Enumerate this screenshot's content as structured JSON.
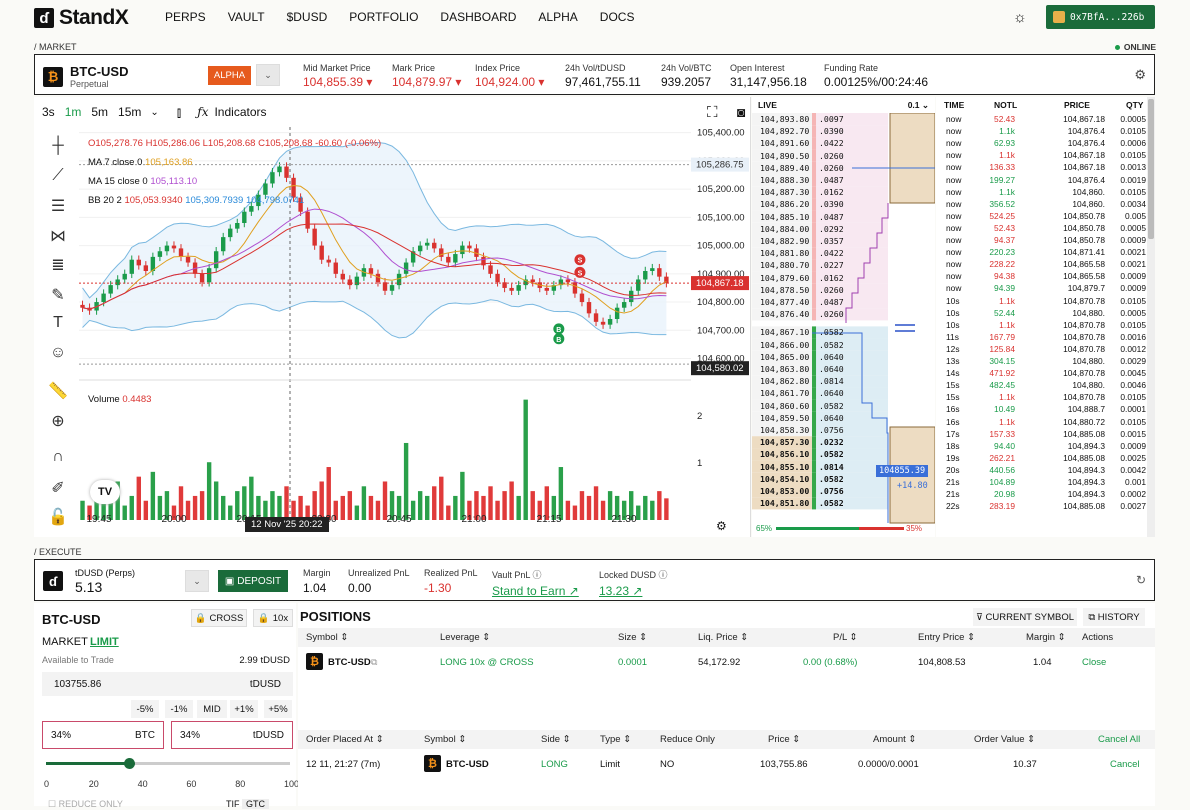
{
  "nav": {
    "logo": "StandX",
    "items": [
      "PERPS",
      "VAULT",
      "$DUSD",
      "PORTFOLIO",
      "DASHBOARD",
      "ALPHA",
      "DOCS"
    ],
    "wallet": "0x7BfA...226b"
  },
  "sections": {
    "market": "/ MARKET",
    "execute": "/ EXECUTE",
    "online": "ONLINE"
  },
  "ticker": {
    "symbol": "BTC-USD",
    "sub": "Perpetual",
    "badge": "ALPHA",
    "stats": [
      {
        "label": "Mid Market Price",
        "value": "104,855.39 ▾",
        "color": "red"
      },
      {
        "label": "Mark Price",
        "value": "104,879.97 ▾",
        "color": "red"
      },
      {
        "label": "Index Price",
        "value": "104,924.00 ▾",
        "color": "red"
      },
      {
        "label": "24h Vol/tDUSD",
        "value": "97,461,755.11",
        "color": "dark"
      },
      {
        "label": "24h Vol/BTC",
        "value": "939.2057",
        "color": "dark"
      },
      {
        "label": "Open Interest",
        "value": "31,147,956.18",
        "color": "dark"
      },
      {
        "label": "Funding Rate",
        "value": "0.00125%/00:24:46",
        "color": "dark"
      }
    ]
  },
  "toolbar": {
    "intervals": [
      "3s",
      "1m",
      "5m",
      "15m"
    ],
    "active": "1m",
    "indicators": "Indicators"
  },
  "chart_legend": {
    "ohlc": "O105,278.76 H105,286.06 L105,208.68 C105,208.68 -60.60 (-0.06%)",
    "ma7": "MA 7 close 0",
    "ma7v": "105,163.86",
    "ma15": "MA 15 close 0",
    "ma15v": "105,113.10",
    "bb": "BB 20 2",
    "bb1": "105,053.9340",
    "bb2": "105,309.7939",
    "bb3": "104,798.0741",
    "volume": "Volume",
    "volumev": "0.4483"
  },
  "chart_data": {
    "type": "candlestick",
    "price_ticks": [
      "105,400.00",
      "105,300.00",
      "105,200.00",
      "105,100.00",
      "105,000.00",
      "104,900.00",
      "104,800.00",
      "104,700.00",
      "104,600.00"
    ],
    "price_values": [
      105400,
      105300,
      105200,
      105100,
      105000,
      104900,
      104800,
      104700,
      104600
    ],
    "ylim": [
      104570,
      105420
    ],
    "time_ticks": [
      "19:45",
      "20:00",
      "20:15",
      "20:30",
      "20:45",
      "21:00",
      "21:15",
      "21:30",
      "21:"
    ],
    "volume_ticks": [
      "2",
      "1"
    ],
    "high_label": "High",
    "high_value": "105,286.75",
    "low_label": "Low",
    "low_value": "104,580.02",
    "last_price": "104,867.18",
    "crosshair_time": "12 Nov '25   20:22",
    "close": [
      104780,
      104770,
      104800,
      104830,
      104860,
      104880,
      104900,
      104950,
      104930,
      104910,
      104960,
      104980,
      105000,
      104990,
      104960,
      104940,
      104900,
      104870,
      104920,
      104980,
      105030,
      105060,
      105080,
      105120,
      105140,
      105180,
      105220,
      105260,
      105280,
      105240,
      105170,
      105120,
      105060,
      105000,
      104950,
      104940,
      104900,
      104880,
      104860,
      104890,
      104920,
      104900,
      104870,
      104840,
      104860,
      104900,
      104940,
      104980,
      105000,
      105010,
      104990,
      104960,
      104940,
      104970,
      105000,
      104990,
      104960,
      104930,
      104900,
      104870,
      104850,
      104840,
      104860,
      104880,
      104870,
      104850,
      104840,
      104860,
      104880,
      104870,
      104830,
      104800,
      104760,
      104730,
      104720,
      104740,
      104780,
      104800,
      104840,
      104880,
      104910,
      104920,
      104890,
      104867
    ],
    "volume": [
      0.4,
      0.3,
      0.5,
      0.6,
      0.4,
      0.8,
      0.3,
      0.5,
      0.9,
      0.4,
      1.0,
      0.5,
      0.6,
      0.3,
      0.7,
      0.4,
      0.5,
      0.6,
      1.2,
      0.8,
      0.5,
      0.3,
      0.6,
      0.7,
      0.9,
      0.5,
      0.4,
      0.6,
      0.5,
      0.7,
      0.4,
      0.5,
      0.3,
      0.6,
      0.8,
      1.1,
      0.4,
      0.5,
      0.6,
      0.3,
      0.7,
      0.5,
      0.4,
      0.8,
      0.6,
      0.5,
      1.6,
      0.4,
      0.6,
      0.5,
      0.7,
      0.9,
      0.3,
      0.5,
      1.0,
      0.4,
      0.6,
      0.5,
      0.7,
      0.4,
      0.6,
      0.8,
      0.5,
      2.5,
      0.6,
      0.4,
      0.7,
      0.5,
      1.1,
      0.4,
      0.3,
      0.6,
      0.5,
      0.7,
      0.4,
      0.6,
      0.5,
      0.4,
      0.6,
      0.3,
      0.5,
      0.4,
      0.6,
      0.45
    ]
  },
  "orderbook": {
    "live": "LIVE",
    "step": "0.1",
    "asks": [
      [
        "104,893.80",
        ".0097"
      ],
      [
        "104,892.70",
        ".0390"
      ],
      [
        "104,891.60",
        ".0422"
      ],
      [
        "104,890.50",
        ".0260"
      ],
      [
        "104,889.40",
        ".0260"
      ],
      [
        "104,888.30",
        ".0487"
      ],
      [
        "104,887.30",
        ".0162"
      ],
      [
        "104,886.20",
        ".0390"
      ],
      [
        "104,885.10",
        ".0487"
      ],
      [
        "104,884.00",
        ".0292"
      ],
      [
        "104,882.90",
        ".0357"
      ],
      [
        "104,881.80",
        ".0422"
      ],
      [
        "104,880.70",
        ".0227"
      ],
      [
        "104,879.60",
        ".0162"
      ],
      [
        "104,878.50",
        ".0260"
      ],
      [
        "104,877.40",
        ".0487"
      ],
      [
        "104,876.40",
        ".0260"
      ]
    ],
    "bids": [
      [
        "104,867.10",
        ".0582"
      ],
      [
        "104,866.00",
        ".0582"
      ],
      [
        "104,865.00",
        ".0640"
      ],
      [
        "104,863.80",
        ".0640"
      ],
      [
        "104,862.80",
        ".0814"
      ],
      [
        "104,861.70",
        ".0640"
      ],
      [
        "104,860.60",
        ".0582"
      ],
      [
        "104,859.50",
        ".0640"
      ],
      [
        "104,858.30",
        ".0756"
      ],
      [
        "104,857.30",
        ".0232"
      ],
      [
        "104,856.10",
        ".0582"
      ],
      [
        "104,855.10",
        ".0814"
      ],
      [
        "104,854.10",
        ".0582"
      ],
      [
        "104,853.00",
        ".0756"
      ],
      [
        "104,851.80",
        ".0582"
      ]
    ],
    "mid": "104855.39",
    "spread": "+14.80",
    "bid_pct": "65%",
    "ask_pct": "35%"
  },
  "trades": {
    "headers": [
      "TIME",
      "NOTL",
      "PRICE",
      "QTY"
    ],
    "rows": [
      [
        "now",
        "52.43",
        "104,867.18",
        "0.0005",
        "r"
      ],
      [
        "now",
        "1.1k",
        "104,876.4",
        "0.0105",
        "g"
      ],
      [
        "now",
        "62.93",
        "104,876.4",
        "0.0006",
        "g"
      ],
      [
        "now",
        "1.1k",
        "104,867.18",
        "0.0105",
        "r"
      ],
      [
        "now",
        "136.33",
        "104,867.18",
        "0.0013",
        "r"
      ],
      [
        "now",
        "199.27",
        "104,876.4",
        "0.0019",
        "g"
      ],
      [
        "now",
        "1.1k",
        "104,860.",
        "0.0105",
        "g"
      ],
      [
        "now",
        "356.52",
        "104,860.",
        "0.0034",
        "g"
      ],
      [
        "now",
        "524.25",
        "104,850.78",
        "0.005",
        "r"
      ],
      [
        "now",
        "52.43",
        "104,850.78",
        "0.0005",
        "r"
      ],
      [
        "now",
        "94.37",
        "104,850.78",
        "0.0009",
        "r"
      ],
      [
        "now",
        "220.23",
        "104,871.41",
        "0.0021",
        "g"
      ],
      [
        "now",
        "228.22",
        "104,865.58",
        "0.0021",
        "r"
      ],
      [
        "now",
        "94.38",
        "104,865.58",
        "0.0009",
        "r"
      ],
      [
        "now",
        "94.39",
        "104,879.7",
        "0.0009",
        "g"
      ],
      [
        "10s",
        "1.1k",
        "104,870.78",
        "0.0105",
        "r"
      ],
      [
        "10s",
        "52.44",
        "104,880.",
        "0.0005",
        "g"
      ],
      [
        "10s",
        "1.1k",
        "104,870.78",
        "0.0105",
        "r"
      ],
      [
        "11s",
        "167.79",
        "104,870.78",
        "0.0016",
        "r"
      ],
      [
        "12s",
        "125.84",
        "104,870.78",
        "0.0012",
        "r"
      ],
      [
        "13s",
        "304.15",
        "104,880.",
        "0.0029",
        "g"
      ],
      [
        "14s",
        "471.92",
        "104,870.78",
        "0.0045",
        "r"
      ],
      [
        "15s",
        "482.45",
        "104,880.",
        "0.0046",
        "g"
      ],
      [
        "15s",
        "1.1k",
        "104,870.78",
        "0.0105",
        "r"
      ],
      [
        "16s",
        "10.49",
        "104,888.7",
        "0.0001",
        "g"
      ],
      [
        "16s",
        "1.1k",
        "104,880.72",
        "0.0105",
        "r"
      ],
      [
        "17s",
        "157.33",
        "104,885.08",
        "0.0015",
        "r"
      ],
      [
        "18s",
        "94.40",
        "104,894.3",
        "0.0009",
        "g"
      ],
      [
        "19s",
        "262.21",
        "104,885.08",
        "0.0025",
        "r"
      ],
      [
        "20s",
        "440.56",
        "104,894.3",
        "0.0042",
        "g"
      ],
      [
        "21s",
        "104.89",
        "104,894.3",
        "0.001",
        "g"
      ],
      [
        "21s",
        "20.98",
        "104,894.3",
        "0.0002",
        "g"
      ],
      [
        "22s",
        "283.19",
        "104,885.08",
        "0.0027",
        "r"
      ]
    ]
  },
  "execute": {
    "account": "tDUSD (Perps)",
    "balance": "5.13",
    "deposit": "DEPOSIT",
    "stats": [
      {
        "label": "Margin",
        "value": "1.04",
        "color": "dark"
      },
      {
        "label": "Unrealized PnL",
        "value": "0.00",
        "color": "dark"
      },
      {
        "label": "Realized PnL",
        "value": "-1.30",
        "color": "red"
      },
      {
        "label": "Vault PnL ⓘ",
        "value": "Stand to Earn ↗",
        "color": "link"
      },
      {
        "label": "Locked DUSD ⓘ",
        "value": "13.23 ↗",
        "color": "link"
      }
    ]
  },
  "order": {
    "symbol": "BTC-USD",
    "cross": "CROSS",
    "lev": "10x",
    "market": "MARKET",
    "limit": "LIMIT",
    "avail_label": "Available to Trade",
    "avail_value": "2.99 tDUSD",
    "price": "103755.86",
    "price_unit": "tDUSD",
    "adj": [
      "-5%",
      "-1%",
      "MID",
      "+1%",
      "+5%"
    ],
    "pct1": "34%",
    "pct1_unit": "BTC",
    "pct2": "34%",
    "pct2_unit": "tDUSD",
    "slider_pct": 34,
    "slider_labels": [
      "0",
      "20",
      "40",
      "60",
      "80",
      "100"
    ],
    "reduce_only": "REDUCE ONLY",
    "tif": "TIF",
    "tif_value": "GTC"
  },
  "positions": {
    "title": "POSITIONS",
    "current": "CURRENT SYMBOL",
    "history": "HISTORY",
    "headers": [
      "Symbol ⇕",
      "Leverage ⇕",
      "Size ⇕",
      "Liq. Price ⇕",
      "P/L ⇕",
      "Entry Price ⇕",
      "Margin ⇕",
      "Actions"
    ],
    "row": [
      "BTC-USD",
      "LONG 10x @ CROSS",
      "0.0001",
      "54,172.92",
      "0.00 (0.68%)",
      "104,808.53",
      "1.04",
      "Close"
    ],
    "order_headers": [
      "Order Placed At ⇕",
      "Symbol ⇕",
      "Side ⇕",
      "Type ⇕",
      "Reduce Only",
      "Price ⇕",
      "Amount ⇕",
      "Order Value ⇕",
      "Cancel All"
    ],
    "order_row": [
      "12 11, 21:27 (7m)",
      "BTC-USD",
      "LONG",
      "Limit",
      "NO",
      "103,755.86",
      "0.0000/0.0001",
      "10.37",
      "Cancel"
    ]
  }
}
